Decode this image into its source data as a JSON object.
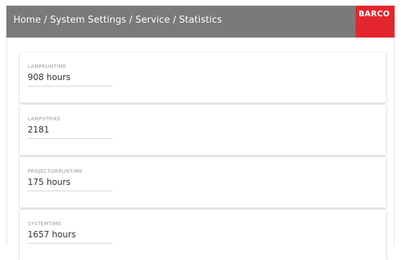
{
  "header": {
    "breadcrumb": "Home / System Settings / Service / Statistics",
    "logo_text": "BARCO",
    "logo_color": "#e3262d",
    "bar_color": "#7a7a7a"
  },
  "stats": [
    {
      "label": "LAMPRUNTIME",
      "value": "908 hours"
    },
    {
      "label": "LAMPSTRIKE",
      "value": "2181"
    },
    {
      "label": "PROJECTORRUNTIME",
      "value": "175 hours"
    },
    {
      "label": "SYSTEMTIME",
      "value": "1657 hours"
    }
  ]
}
